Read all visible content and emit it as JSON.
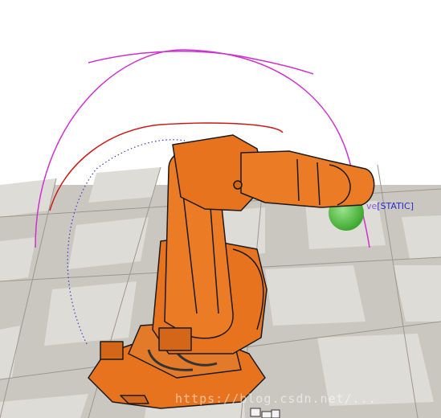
{
  "scene": {
    "target_label_prefix": "ve",
    "target_label": "[STATIC]",
    "watermark": "https://blog.csdn.net/..."
  },
  "colors": {
    "robot_body": "#e8731f",
    "robot_outline": "#1a1a1a",
    "trajectory_outer": "#cc33cc",
    "trajectory_inner": "#cc1a1a",
    "trajectory_dotted": "#3a3ad0",
    "target_sphere": "#5ec44a",
    "floor_light": "#d8d6cf",
    "floor_dark": "#a9a79f"
  },
  "icons": {
    "robot": "industrial-robot-arm-icon",
    "target": "target-sphere-icon",
    "axis": "coordinate-axis-icon"
  }
}
